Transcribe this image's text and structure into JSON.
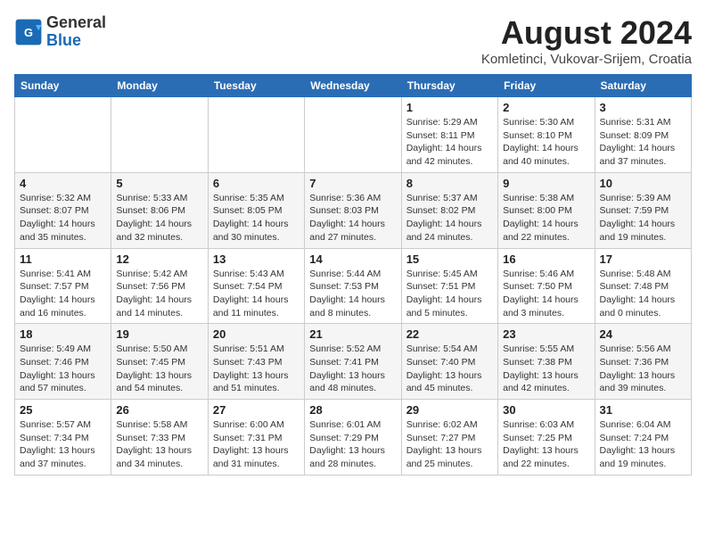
{
  "header": {
    "logo_general": "General",
    "logo_blue": "Blue",
    "month_year": "August 2024",
    "location": "Komletinci, Vukovar-Srijem, Croatia"
  },
  "days_of_week": [
    "Sunday",
    "Monday",
    "Tuesday",
    "Wednesday",
    "Thursday",
    "Friday",
    "Saturday"
  ],
  "weeks": [
    [
      {
        "day": "",
        "info": ""
      },
      {
        "day": "",
        "info": ""
      },
      {
        "day": "",
        "info": ""
      },
      {
        "day": "",
        "info": ""
      },
      {
        "day": "1",
        "info": "Sunrise: 5:29 AM\nSunset: 8:11 PM\nDaylight: 14 hours and 42 minutes."
      },
      {
        "day": "2",
        "info": "Sunrise: 5:30 AM\nSunset: 8:10 PM\nDaylight: 14 hours and 40 minutes."
      },
      {
        "day": "3",
        "info": "Sunrise: 5:31 AM\nSunset: 8:09 PM\nDaylight: 14 hours and 37 minutes."
      }
    ],
    [
      {
        "day": "4",
        "info": "Sunrise: 5:32 AM\nSunset: 8:07 PM\nDaylight: 14 hours and 35 minutes."
      },
      {
        "day": "5",
        "info": "Sunrise: 5:33 AM\nSunset: 8:06 PM\nDaylight: 14 hours and 32 minutes."
      },
      {
        "day": "6",
        "info": "Sunrise: 5:35 AM\nSunset: 8:05 PM\nDaylight: 14 hours and 30 minutes."
      },
      {
        "day": "7",
        "info": "Sunrise: 5:36 AM\nSunset: 8:03 PM\nDaylight: 14 hours and 27 minutes."
      },
      {
        "day": "8",
        "info": "Sunrise: 5:37 AM\nSunset: 8:02 PM\nDaylight: 14 hours and 24 minutes."
      },
      {
        "day": "9",
        "info": "Sunrise: 5:38 AM\nSunset: 8:00 PM\nDaylight: 14 hours and 22 minutes."
      },
      {
        "day": "10",
        "info": "Sunrise: 5:39 AM\nSunset: 7:59 PM\nDaylight: 14 hours and 19 minutes."
      }
    ],
    [
      {
        "day": "11",
        "info": "Sunrise: 5:41 AM\nSunset: 7:57 PM\nDaylight: 14 hours and 16 minutes."
      },
      {
        "day": "12",
        "info": "Sunrise: 5:42 AM\nSunset: 7:56 PM\nDaylight: 14 hours and 14 minutes."
      },
      {
        "day": "13",
        "info": "Sunrise: 5:43 AM\nSunset: 7:54 PM\nDaylight: 14 hours and 11 minutes."
      },
      {
        "day": "14",
        "info": "Sunrise: 5:44 AM\nSunset: 7:53 PM\nDaylight: 14 hours and 8 minutes."
      },
      {
        "day": "15",
        "info": "Sunrise: 5:45 AM\nSunset: 7:51 PM\nDaylight: 14 hours and 5 minutes."
      },
      {
        "day": "16",
        "info": "Sunrise: 5:46 AM\nSunset: 7:50 PM\nDaylight: 14 hours and 3 minutes."
      },
      {
        "day": "17",
        "info": "Sunrise: 5:48 AM\nSunset: 7:48 PM\nDaylight: 14 hours and 0 minutes."
      }
    ],
    [
      {
        "day": "18",
        "info": "Sunrise: 5:49 AM\nSunset: 7:46 PM\nDaylight: 13 hours and 57 minutes."
      },
      {
        "day": "19",
        "info": "Sunrise: 5:50 AM\nSunset: 7:45 PM\nDaylight: 13 hours and 54 minutes."
      },
      {
        "day": "20",
        "info": "Sunrise: 5:51 AM\nSunset: 7:43 PM\nDaylight: 13 hours and 51 minutes."
      },
      {
        "day": "21",
        "info": "Sunrise: 5:52 AM\nSunset: 7:41 PM\nDaylight: 13 hours and 48 minutes."
      },
      {
        "day": "22",
        "info": "Sunrise: 5:54 AM\nSunset: 7:40 PM\nDaylight: 13 hours and 45 minutes."
      },
      {
        "day": "23",
        "info": "Sunrise: 5:55 AM\nSunset: 7:38 PM\nDaylight: 13 hours and 42 minutes."
      },
      {
        "day": "24",
        "info": "Sunrise: 5:56 AM\nSunset: 7:36 PM\nDaylight: 13 hours and 39 minutes."
      }
    ],
    [
      {
        "day": "25",
        "info": "Sunrise: 5:57 AM\nSunset: 7:34 PM\nDaylight: 13 hours and 37 minutes."
      },
      {
        "day": "26",
        "info": "Sunrise: 5:58 AM\nSunset: 7:33 PM\nDaylight: 13 hours and 34 minutes."
      },
      {
        "day": "27",
        "info": "Sunrise: 6:00 AM\nSunset: 7:31 PM\nDaylight: 13 hours and 31 minutes."
      },
      {
        "day": "28",
        "info": "Sunrise: 6:01 AM\nSunset: 7:29 PM\nDaylight: 13 hours and 28 minutes."
      },
      {
        "day": "29",
        "info": "Sunrise: 6:02 AM\nSunset: 7:27 PM\nDaylight: 13 hours and 25 minutes."
      },
      {
        "day": "30",
        "info": "Sunrise: 6:03 AM\nSunset: 7:25 PM\nDaylight: 13 hours and 22 minutes."
      },
      {
        "day": "31",
        "info": "Sunrise: 6:04 AM\nSunset: 7:24 PM\nDaylight: 13 hours and 19 minutes."
      }
    ]
  ]
}
